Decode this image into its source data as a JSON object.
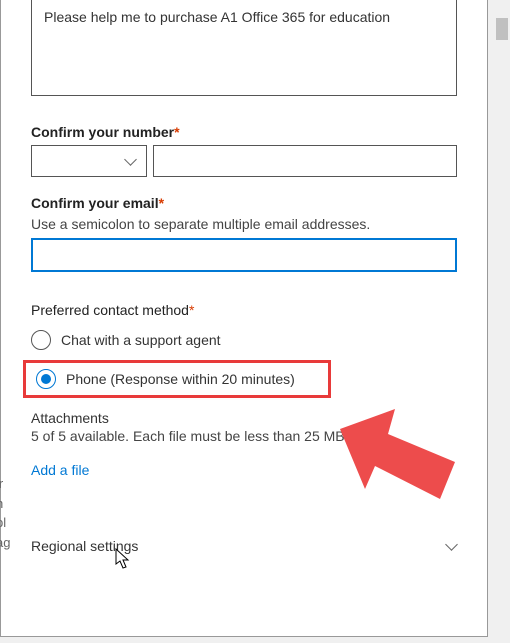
{
  "description": "Please help me to purchase A1 Office 365 for education",
  "fields": {
    "confirm_number_label": "Confirm your number",
    "confirm_email_label": "Confirm your email",
    "email_hint": "Use a semicolon to separate multiple email addresses."
  },
  "contact_method": {
    "label": "Preferred contact method",
    "options": {
      "chat": "Chat with a support agent",
      "phone": "Phone (Response within 20 minutes)"
    }
  },
  "attachments": {
    "label": "Attachments",
    "hint_prefix": "5 of 5 available. Each file must be less than 25 MB in",
    "add_file": "Add a file"
  },
  "regional": {
    "label": "Regional settings"
  },
  "colors": {
    "accent": "#0078d4",
    "highlight": "#e83a3a",
    "required": "#d83b01"
  }
}
